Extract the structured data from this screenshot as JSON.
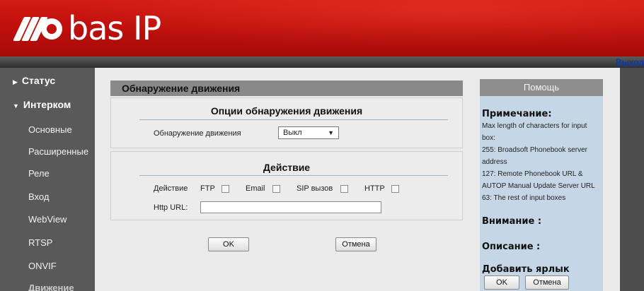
{
  "header": {
    "logo_text": "bas IP",
    "logout_label": "Выход"
  },
  "sidebar": {
    "items": [
      {
        "label": "Статус",
        "type": "top"
      },
      {
        "label": "Интерком",
        "type": "top"
      },
      {
        "label": "Основные",
        "type": "sub"
      },
      {
        "label": "Расширенные",
        "type": "sub"
      },
      {
        "label": "Реле",
        "type": "sub"
      },
      {
        "label": "Вход",
        "type": "sub"
      },
      {
        "label": "WebView",
        "type": "sub"
      },
      {
        "label": "RTSP",
        "type": "sub"
      },
      {
        "label": "ONVIF",
        "type": "sub"
      },
      {
        "label": "Движение",
        "type": "sub",
        "active": true
      }
    ]
  },
  "main": {
    "title": "Обнаружение движения",
    "options": {
      "title": "Опции обнаружения движения",
      "motion_label": "Обнаружение движения",
      "motion_value": "Выкл"
    },
    "action": {
      "title": "Действие",
      "action_label": "Действие",
      "ftp_label": "FTP",
      "email_label": "Email",
      "sip_label": "SIP вызов",
      "http_label": "HTTP",
      "http_url_label": "Http URL:",
      "http_url_value": ""
    },
    "ok_label": "OK",
    "cancel_label": "Отмена"
  },
  "help": {
    "title": "Помощь",
    "note_heading": "Примечание:",
    "note_lines": [
      "Max length of characters for input box:",
      "255: Broadsoft Phonebook server address",
      "127: Remote Phonebook URL & AUTOP Manual Update Server URL",
      "63: The rest of input boxes"
    ],
    "warning_heading": "Внимание :",
    "description_heading": "Описание :",
    "add_shortcut_heading": "Добавить ярлык",
    "ok_label": "OK",
    "cancel_label": "Отмена"
  },
  "colors": {
    "header_red": "#c0100c",
    "help_bg": "#c5d7e6",
    "logout_link": "#0a3aa8"
  }
}
